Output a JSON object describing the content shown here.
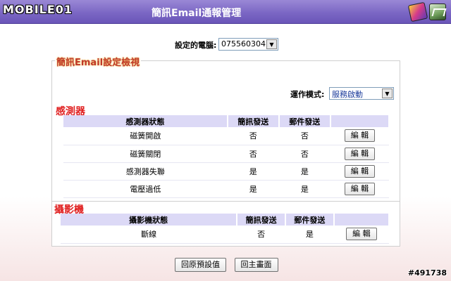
{
  "header": {
    "logo_text": "MOBILE01",
    "title": "簡訊Email通報管理",
    "icons": [
      "help-book-icon",
      "admin-tool-icon"
    ]
  },
  "computer": {
    "label": "設定的電腦:",
    "value": "075560304"
  },
  "section": {
    "title": "簡訊Email設定檢視"
  },
  "mode": {
    "label": "運作模式:",
    "value": "服務啟動"
  },
  "sensors": {
    "title": "感測器",
    "headers": [
      "感測器狀態",
      "簡訊發送",
      "郵件發送",
      ""
    ],
    "rows": [
      {
        "state": "磁簧開啟",
        "sms": "否",
        "email": "否",
        "edit": "編 輯"
      },
      {
        "state": "磁簧關閉",
        "sms": "否",
        "email": "否",
        "edit": "編 輯"
      },
      {
        "state": "感測器失聯",
        "sms": "是",
        "email": "是",
        "edit": "編 輯"
      },
      {
        "state": "電壓過低",
        "sms": "是",
        "email": "是",
        "edit": "編 輯"
      }
    ]
  },
  "cameras": {
    "title": "攝影機",
    "headers": [
      "攝影機狀態",
      "簡訊發送",
      "郵件發送",
      ""
    ],
    "rows": [
      {
        "state": "斷線",
        "sms": "否",
        "email": "是",
        "edit": "編 輯"
      }
    ]
  },
  "footer": {
    "reset_label": "回原預設值",
    "home_label": "回主畫面"
  },
  "watermark": "#491738"
}
